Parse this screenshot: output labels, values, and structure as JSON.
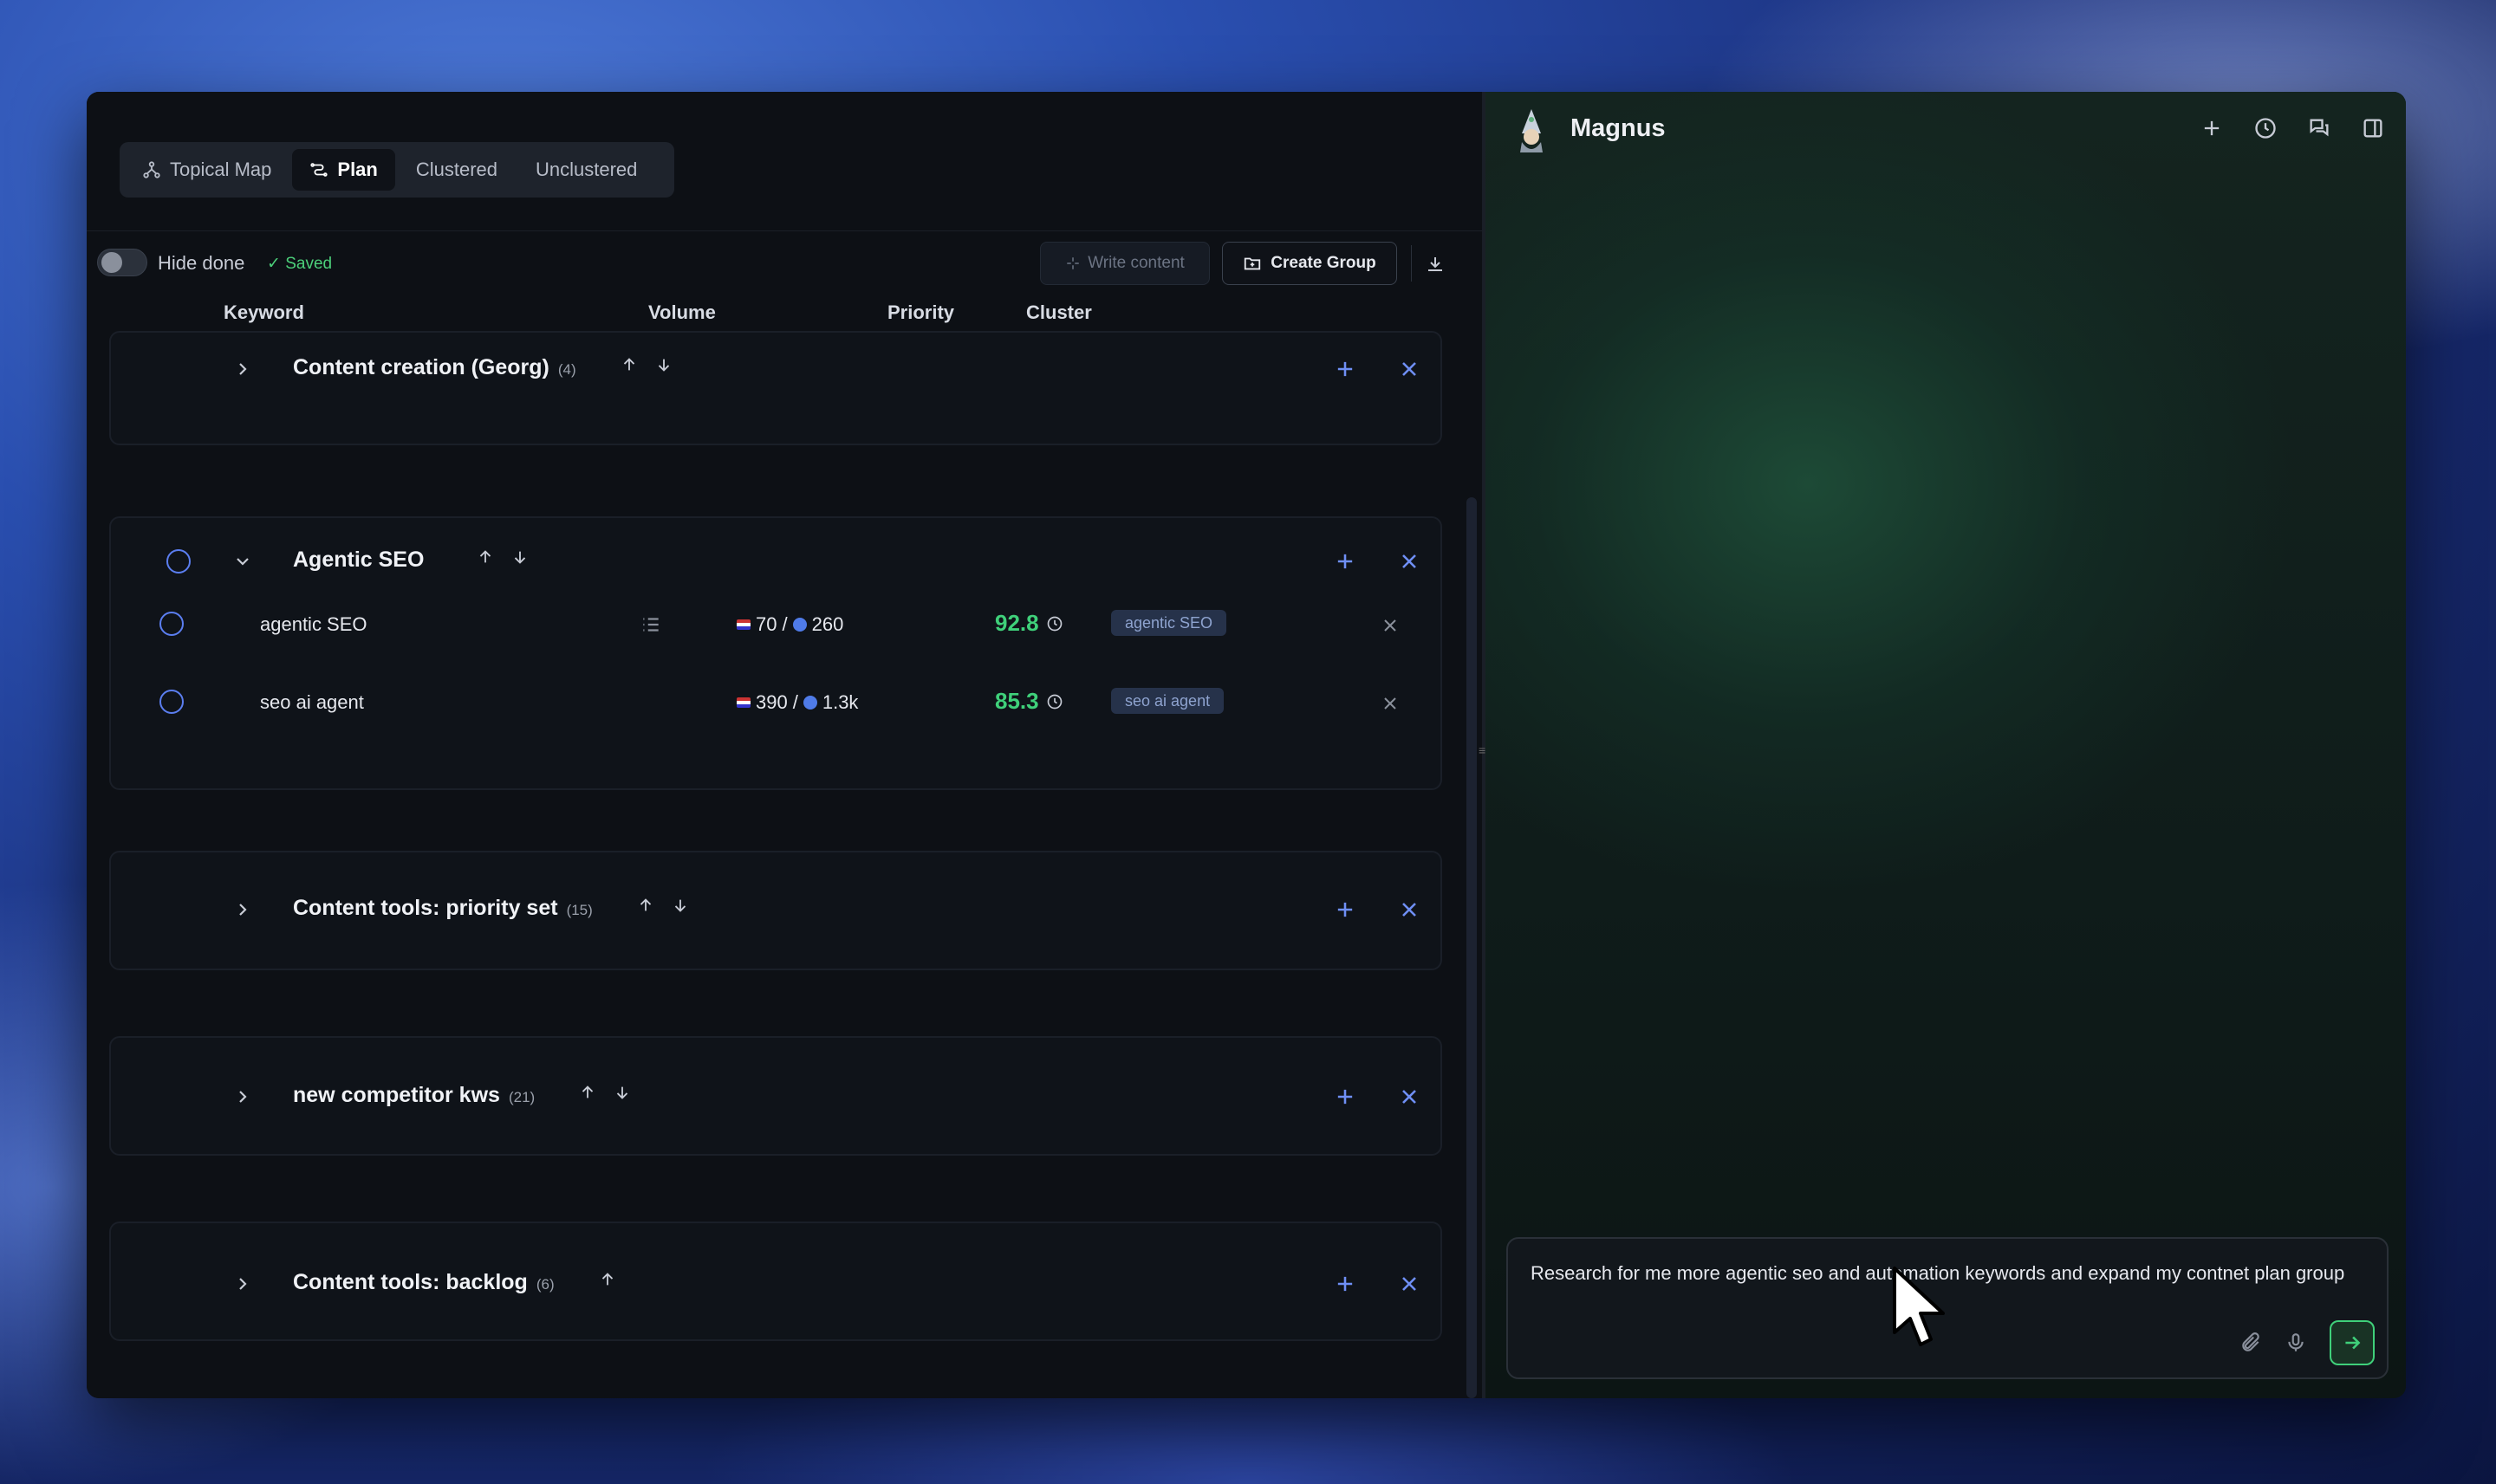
{
  "tabs": [
    {
      "label": "Topical Map",
      "icon": "topical-map-icon",
      "active": false
    },
    {
      "label": "Plan",
      "icon": "plan-icon",
      "active": true
    },
    {
      "label": "Clustered",
      "active": false
    },
    {
      "label": "Unclustered",
      "active": false
    }
  ],
  "toolbar": {
    "hide_done_label": "Hide done",
    "saved_label": "✓ Saved",
    "write_content_label": "Write content",
    "create_group_label": "Create Group"
  },
  "columns": {
    "keyword": "Keyword",
    "volume": "Volume",
    "priority": "Priority",
    "cluster": "Cluster"
  },
  "groups": [
    {
      "title": "Content creation (Georg)",
      "count": "(4)",
      "expanded": false
    },
    {
      "title": "Agentic SEO",
      "count": "",
      "expanded": true,
      "rows": [
        {
          "keyword": "agentic SEO",
          "us_volume": "70",
          "global_volume": "260",
          "priority": "92.8",
          "cluster": "agentic SEO"
        },
        {
          "keyword": "seo ai agent",
          "us_volume": "390",
          "global_volume": "1.3k",
          "priority": "85.3",
          "cluster": "seo ai agent"
        }
      ]
    },
    {
      "title": "Content tools: priority set",
      "count": "(15)",
      "expanded": false
    },
    {
      "title": "new competitor kws",
      "count": "(21)",
      "expanded": false
    },
    {
      "title": "Content tools: backlog",
      "count": "(6)",
      "expanded": false
    }
  ],
  "chat": {
    "agent_name": "Magnus",
    "composer_text": "Research for me more agentic seo and automation keywords and expand my contnet plan group"
  },
  "colors": {
    "accent_blue": "#5b7ef0",
    "priority_green": "#3fd07a"
  }
}
